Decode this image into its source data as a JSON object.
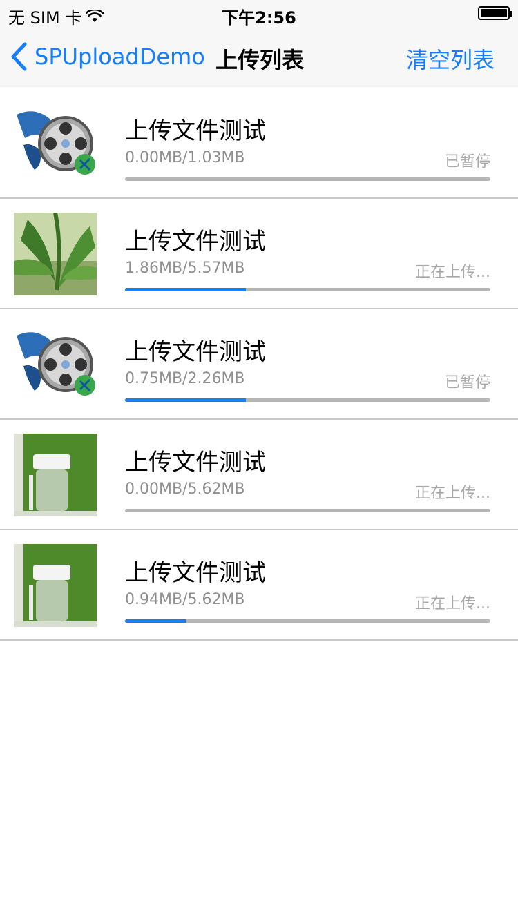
{
  "status_bar": {
    "carrier": "无 SIM 卡",
    "time": "下午2:56"
  },
  "nav": {
    "back_label": "SPUploadDemo",
    "title": "上传列表",
    "right_label": "清空列表"
  },
  "colors": {
    "accent": "#147efb",
    "track": "#b5b5b5"
  },
  "uploads": [
    {
      "title": "上传文件测试",
      "size": "0.00MB/1.03MB",
      "status": "已暂停",
      "thumb": "video-icon",
      "progress": 0.0
    },
    {
      "title": "上传文件测试",
      "size": "1.86MB/5.57MB",
      "status": "正在上传...",
      "thumb": "plant-photo",
      "progress": 0.33
    },
    {
      "title": "上传文件测试",
      "size": "0.75MB/2.26MB",
      "status": "已暂停",
      "thumb": "video-icon",
      "progress": 0.33
    },
    {
      "title": "上传文件测试",
      "size": "0.00MB/5.62MB",
      "status": "正在上传...",
      "thumb": "jar-photo",
      "progress": 0.0
    },
    {
      "title": "上传文件测试",
      "size": "0.94MB/5.62MB",
      "status": "正在上传...",
      "thumb": "jar-photo",
      "progress": 0.167
    }
  ]
}
